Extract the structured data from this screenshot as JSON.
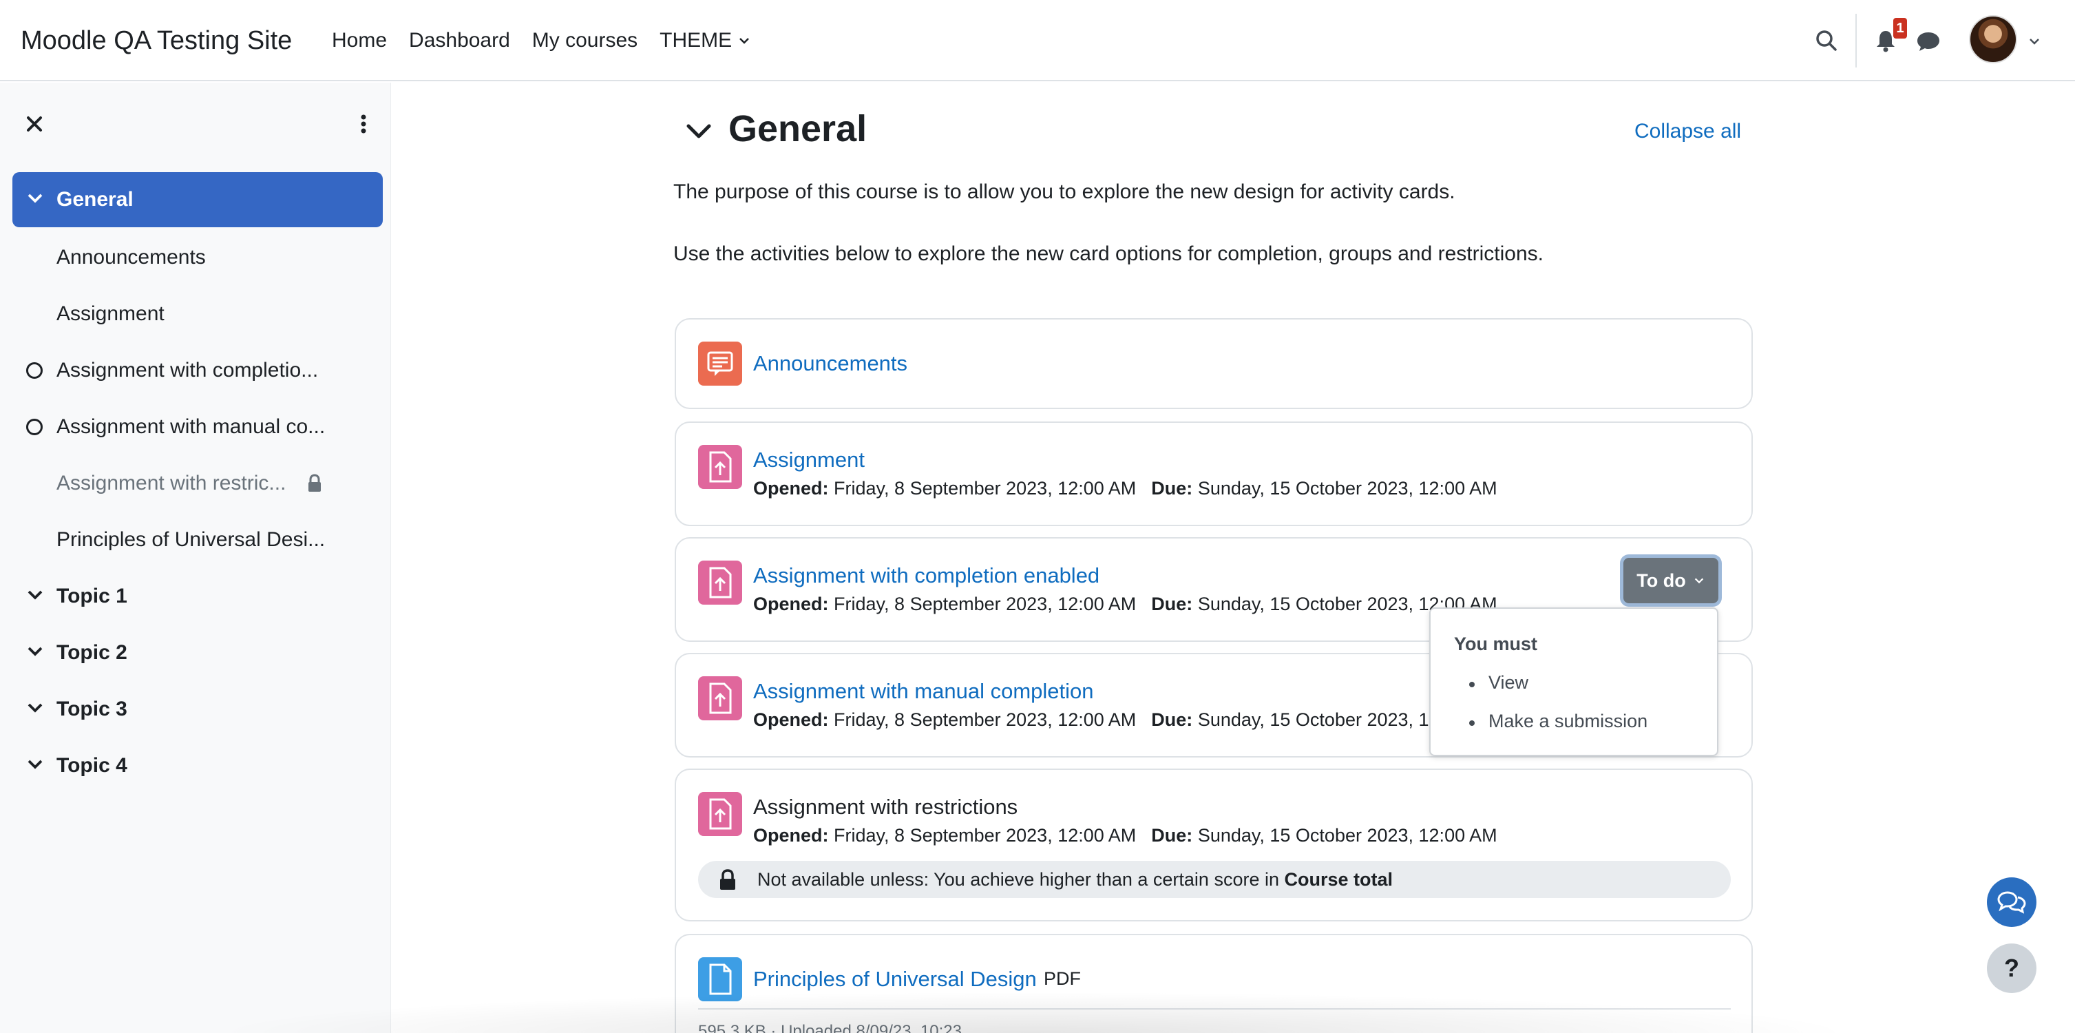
{
  "navbar": {
    "brand": "Moodle QA Testing Site",
    "links": [
      "Home",
      "Dashboard",
      "My courses",
      "THEME"
    ],
    "notification_count": "1"
  },
  "drawer": {
    "items": [
      {
        "label": "General",
        "kind": "section",
        "active": true
      },
      {
        "label": "Announcements",
        "kind": "activity"
      },
      {
        "label": "Assignment",
        "kind": "activity"
      },
      {
        "label": "Assignment with completio...",
        "kind": "completion"
      },
      {
        "label": "Assignment with manual co...",
        "kind": "completion"
      },
      {
        "label": "Assignment with restric...",
        "kind": "restricted"
      },
      {
        "label": "Principles of Universal Desi...",
        "kind": "activity"
      },
      {
        "label": "Topic 1",
        "kind": "section"
      },
      {
        "label": "Topic 2",
        "kind": "section"
      },
      {
        "label": "Topic 3",
        "kind": "section"
      },
      {
        "label": "Topic 4",
        "kind": "section"
      }
    ]
  },
  "main": {
    "section_title": "General",
    "collapse_all": "Collapse all",
    "summary": [
      "The purpose of this course is to allow you to explore the new design for activity cards.",
      "Use the activities below to explore the new card options for completion, groups and restrictions."
    ],
    "opened_label": "Opened:",
    "due_label": "Due:",
    "opened_value": "Friday, 8 September 2023, 12:00 AM",
    "due_value": "Sunday, 15 October 2023, 12:00 AM",
    "activities": [
      {
        "title": "Announcements",
        "type": "forum"
      },
      {
        "title": "Assignment",
        "type": "assign"
      },
      {
        "title": "Assignment with completion enabled",
        "type": "assign"
      },
      {
        "title": "Assignment with manual completion",
        "type": "assign"
      },
      {
        "title": "Assignment with restrictions",
        "type": "assign"
      },
      {
        "title": "Principles of Universal Design",
        "type": "resource",
        "tag": "PDF"
      }
    ],
    "completion_button": "To do",
    "popover": {
      "heading": "You must",
      "items": [
        "View",
        "Make a submission"
      ]
    },
    "restriction": {
      "prefix": "Not available unless: You achieve higher than a certain score in ",
      "bold": "Course total"
    },
    "truncated_text": "595.3 KB · Uploaded 8/09/23, 10:23"
  },
  "colors": {
    "brand_blue": "#0f6cbf",
    "active_item": "#3567c4",
    "forum_icon": "#eb6b50",
    "assign_icon": "#e0679c",
    "resource_icon": "#3d9ee5",
    "badge": "#ca3120"
  },
  "icons": [
    "search-icon",
    "bell-icon",
    "chat-icon",
    "close-icon",
    "kebab-icon",
    "chevron-down-icon",
    "lock-icon",
    "help-icon"
  ]
}
